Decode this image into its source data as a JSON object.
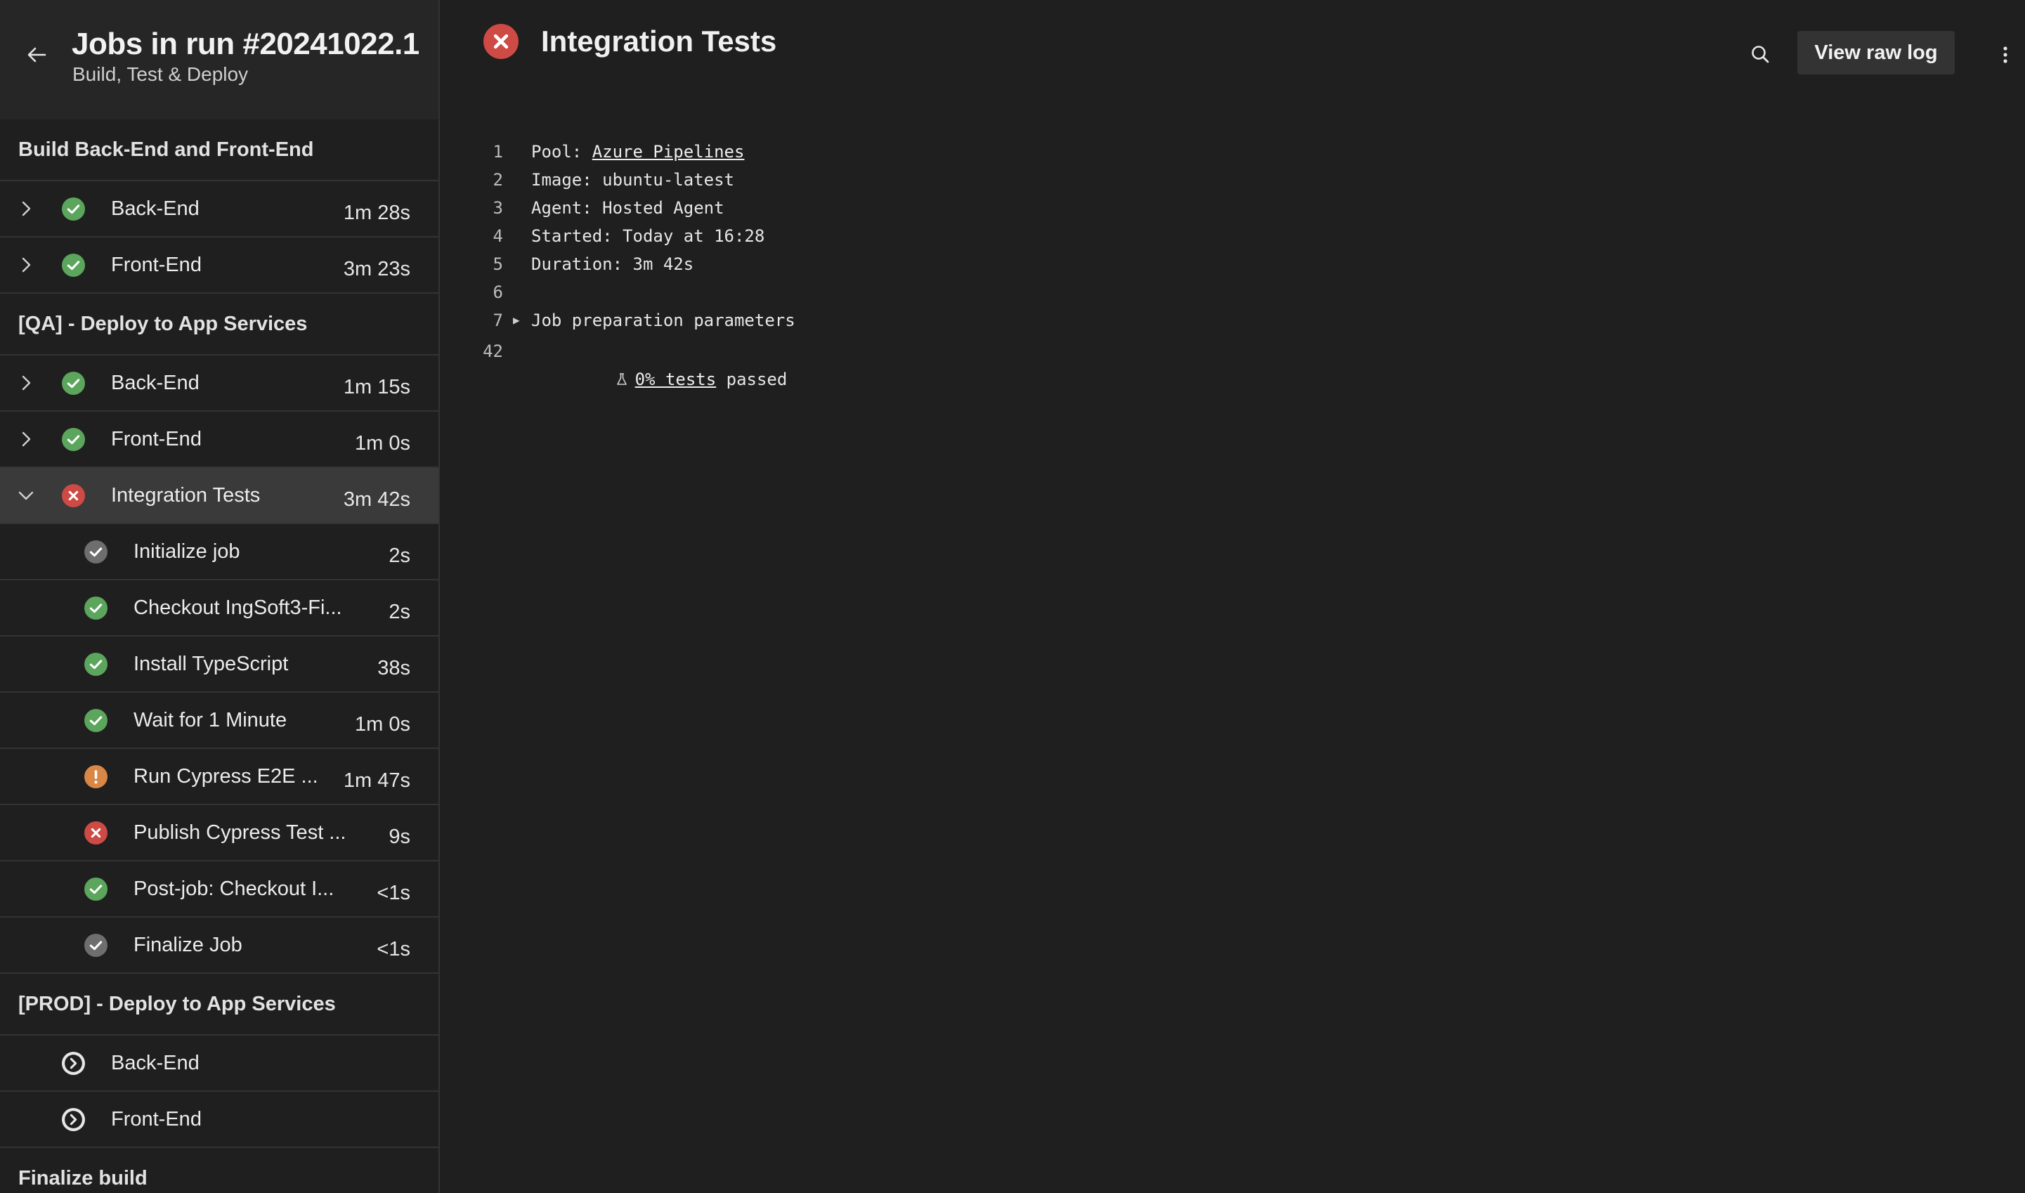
{
  "sidebar": {
    "title": "Jobs in run #20241022.1",
    "subtitle": "Build, Test & Deploy",
    "stages": [
      {
        "name": "Build Back-End and Front-End",
        "jobs": [
          {
            "label": "Back-End",
            "duration": "1m 28s",
            "status": "success"
          },
          {
            "label": "Front-End",
            "duration": "3m 23s",
            "status": "success"
          }
        ]
      },
      {
        "name": "[QA] - Deploy to App Services",
        "jobs": [
          {
            "label": "Back-End",
            "duration": "1m 15s",
            "status": "success"
          },
          {
            "label": "Front-End",
            "duration": "1m 0s",
            "status": "success"
          },
          {
            "label": "Integration Tests",
            "duration": "3m 42s",
            "status": "failed",
            "expanded": true,
            "steps": [
              {
                "label": "Initialize job",
                "duration": "2s",
                "status": "done"
              },
              {
                "label": "Checkout IngSoft3-Fi...",
                "duration": "2s",
                "status": "success"
              },
              {
                "label": "Install TypeScript",
                "duration": "38s",
                "status": "success"
              },
              {
                "label": "Wait for 1 Minute",
                "duration": "1m 0s",
                "status": "success"
              },
              {
                "label": "Run Cypress E2E ...",
                "duration": "1m 47s",
                "status": "warning"
              },
              {
                "label": "Publish Cypress Test ...",
                "duration": "9s",
                "status": "failed"
              },
              {
                "label": "Post-job: Checkout I...",
                "duration": "<1s",
                "status": "success"
              },
              {
                "label": "Finalize Job",
                "duration": "<1s",
                "status": "done"
              }
            ]
          }
        ]
      },
      {
        "name": "[PROD] - Deploy to App Services",
        "jobs": [
          {
            "label": "Back-End",
            "duration": "",
            "status": "pending"
          },
          {
            "label": "Front-End",
            "duration": "",
            "status": "pending"
          }
        ]
      },
      {
        "name": "Finalize build",
        "jobs": []
      }
    ]
  },
  "main": {
    "title": "Integration Tests",
    "status": "failed",
    "view_raw_log": "View raw log",
    "log": {
      "line1": {
        "num": "1",
        "prefix": "Pool: ",
        "link": "Azure Pipelines"
      },
      "line2": {
        "num": "2",
        "text": "Image: ubuntu-latest"
      },
      "line3": {
        "num": "3",
        "text": "Agent: Hosted Agent"
      },
      "line4": {
        "num": "4",
        "text": "Started: Today at 16:28"
      },
      "line5": {
        "num": "5",
        "text": "Duration: 3m 42s"
      },
      "line6": {
        "num": "6",
        "text": ""
      },
      "line7": {
        "num": "7",
        "text": "Job preparation parameters"
      },
      "line42": {
        "num": "42",
        "link": "0% tests",
        "suffix": " passed"
      }
    }
  },
  "colors": {
    "success": "#5ba55c",
    "failed": "#cd4a45",
    "warning": "#d98746",
    "done": "#6e6e6e",
    "pending": "#e6e6e6"
  }
}
